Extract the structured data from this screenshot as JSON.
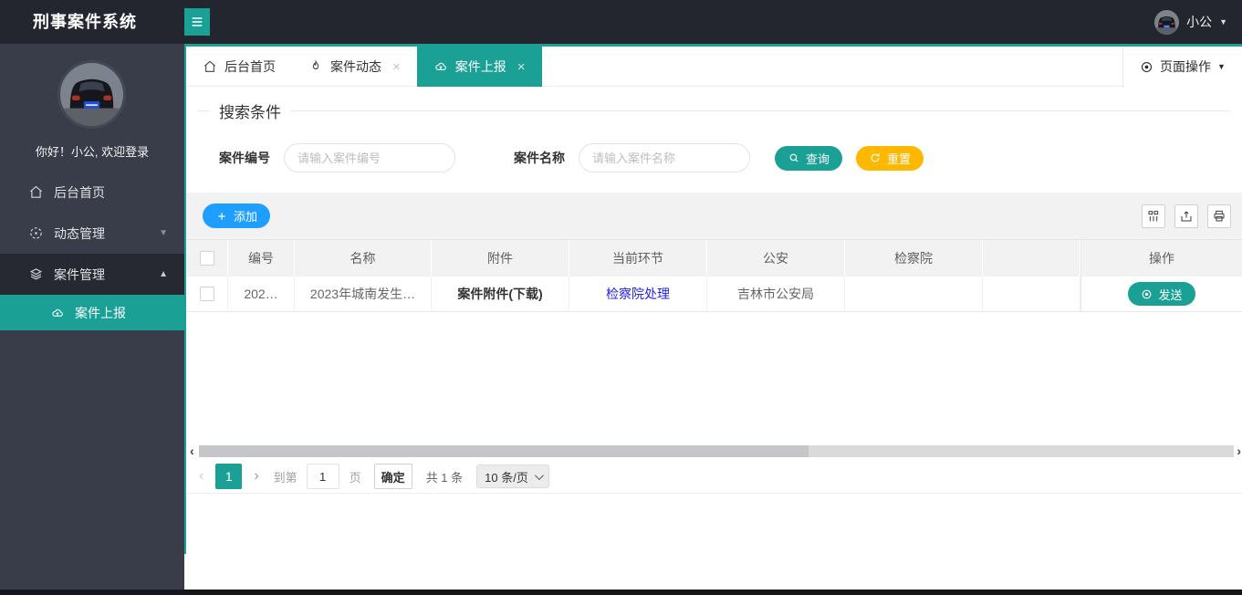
{
  "topbar": {
    "title": "刑事案件系统",
    "user": "小公"
  },
  "sidebar": {
    "welcome": "你好！小公, 欢迎登录",
    "items": [
      {
        "label": "后台首页"
      },
      {
        "label": "动态管理"
      },
      {
        "label": "案件管理"
      },
      {
        "label": "案件上报"
      }
    ]
  },
  "tabs": [
    {
      "label": "后台首页"
    },
    {
      "label": "案件动态"
    },
    {
      "label": "案件上报"
    }
  ],
  "page_ops": {
    "label": "页面操作"
  },
  "search": {
    "legend": "搜索条件",
    "fields": [
      {
        "label": "案件编号",
        "placeholder": "请输入案件编号"
      },
      {
        "label": "案件名称",
        "placeholder": "请输入案件名称"
      }
    ],
    "query_label": "查询",
    "reset_label": "重置"
  },
  "toolbar": {
    "add_label": "添加"
  },
  "table": {
    "headers": [
      "编号",
      "名称",
      "附件",
      "当前环节",
      "公安",
      "检察院",
      "",
      "操作"
    ],
    "rows": [
      {
        "id": "202…",
        "name": "2023年城南发生…",
        "attachment": "案件附件(下载)",
        "stage": "检察院处理",
        "police": "吉林市公安局",
        "procuratorate": "",
        "blank": "",
        "action_label": "发送"
      }
    ]
  },
  "pagination": {
    "current": "1",
    "goto_prefix": "到第",
    "goto_value": "1",
    "goto_suffix": "页",
    "confirm_label": "确定",
    "total": "共 1 条",
    "page_size": "10 条/页"
  },
  "glyphs": {
    "close": "×",
    "caret_down": "▼",
    "caret_up": "▲",
    "chev_left": "‹",
    "chev_right": "›"
  },
  "icons": {
    "hamburger": "menu-icon",
    "user_avatar": "car-photo-avatar",
    "tab_home": "home-icon",
    "tab_dynamic": "flame-icon",
    "tab_upload": "cloud-upload-icon",
    "page_ops": "dot-circle-icon",
    "menu_home": "home-icon",
    "menu_dynamic": "dashed-circle-icon",
    "menu_case": "layers-icon",
    "menu_upload": "cloud-upload-icon",
    "query": "search-icon",
    "reset": "refresh-icon",
    "add": "plus-icon",
    "tool_1": "columns-filter-icon",
    "tool_2": "export-icon",
    "tool_3": "printer-icon",
    "send": "dot-circle-icon"
  },
  "colors": {
    "accent": "#1aa094",
    "add_blue": "#1e9fff",
    "reset_yellow": "#ffb800",
    "link_blue": "#2222dd",
    "topbar_bg": "#23262e",
    "sidebar_bg": "#393d49"
  }
}
